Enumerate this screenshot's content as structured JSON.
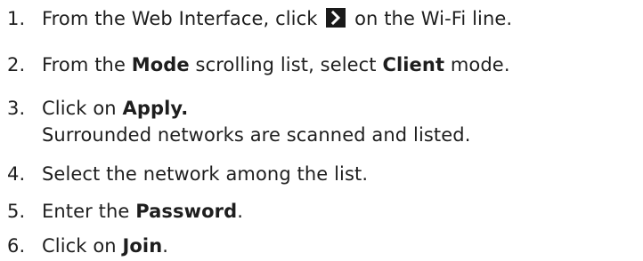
{
  "steps": [
    {
      "number": "1.",
      "parts": {
        "t1": "From the Web Interface, click",
        "t2": "on the Wi-Fi line."
      },
      "icon": "chevron-right-icon"
    },
    {
      "number": "2.",
      "parts": {
        "t1": "From the",
        "b1": "Mode",
        "t2": "scrolling list, select",
        "b2": "Client",
        "t3": "mode."
      }
    },
    {
      "number": "3.",
      "parts": {
        "t1": "Click on",
        "b1": "Apply.",
        "sub": "Surrounded networks are scanned and listed."
      }
    },
    {
      "number": "4.",
      "parts": {
        "t1": "Select the network among the list."
      }
    },
    {
      "number": "5.",
      "parts": {
        "t1": "Enter the",
        "b1": "Password",
        "t2": "."
      }
    },
    {
      "number": "6.",
      "parts": {
        "t1": "Click on",
        "b1": "Join",
        "t2": "."
      }
    }
  ]
}
